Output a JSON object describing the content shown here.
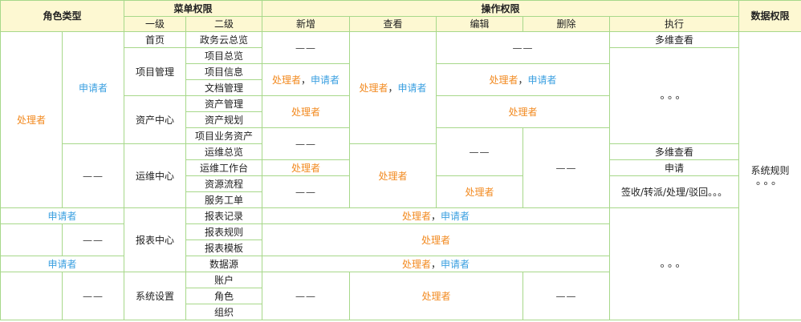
{
  "header": {
    "role_type": "角色类型",
    "menu_perm": "菜单权限",
    "op_perm": "操作权限",
    "data_perm": "数据权限",
    "level1": "一级",
    "level2": "二级",
    "add": "新增",
    "view": "查看",
    "edit": "编辑",
    "delete": "删除",
    "execute": "执行"
  },
  "roles": {
    "handler": "处理者",
    "applicant": "申请者",
    "sep": "，",
    "dash": "——",
    "dots": "。。。"
  },
  "menu": {
    "home": "首页",
    "gov_overview": "政务云总览",
    "project_mgmt": "项目管理",
    "project_overview": "项目总览",
    "project_info": "项目信息",
    "doc_mgmt": "文档管理",
    "asset_center": "资产中心",
    "asset_mgmt": "资产管理",
    "asset_plan": "资产规划",
    "project_asset": "项目业务资产",
    "ops_center": "运维中心",
    "ops_overview": "运维总览",
    "ops_workbench": "运维工作台",
    "resource_flow": "资源流程",
    "service_ticket": "服务工单",
    "report_center": "报表中心",
    "report_record": "报表记录",
    "report_rule": "报表规则",
    "report_template": "报表模板",
    "data_source": "数据源",
    "sys_settings": "系统设置",
    "account": "账户",
    "role": "角色",
    "org": "组织"
  },
  "exec": {
    "multi_view": "多维查看",
    "apply": "申请",
    "sign": "签收/转派/处理/驳回。。。"
  },
  "data_perm": {
    "system_rule": "系统规则"
  }
}
